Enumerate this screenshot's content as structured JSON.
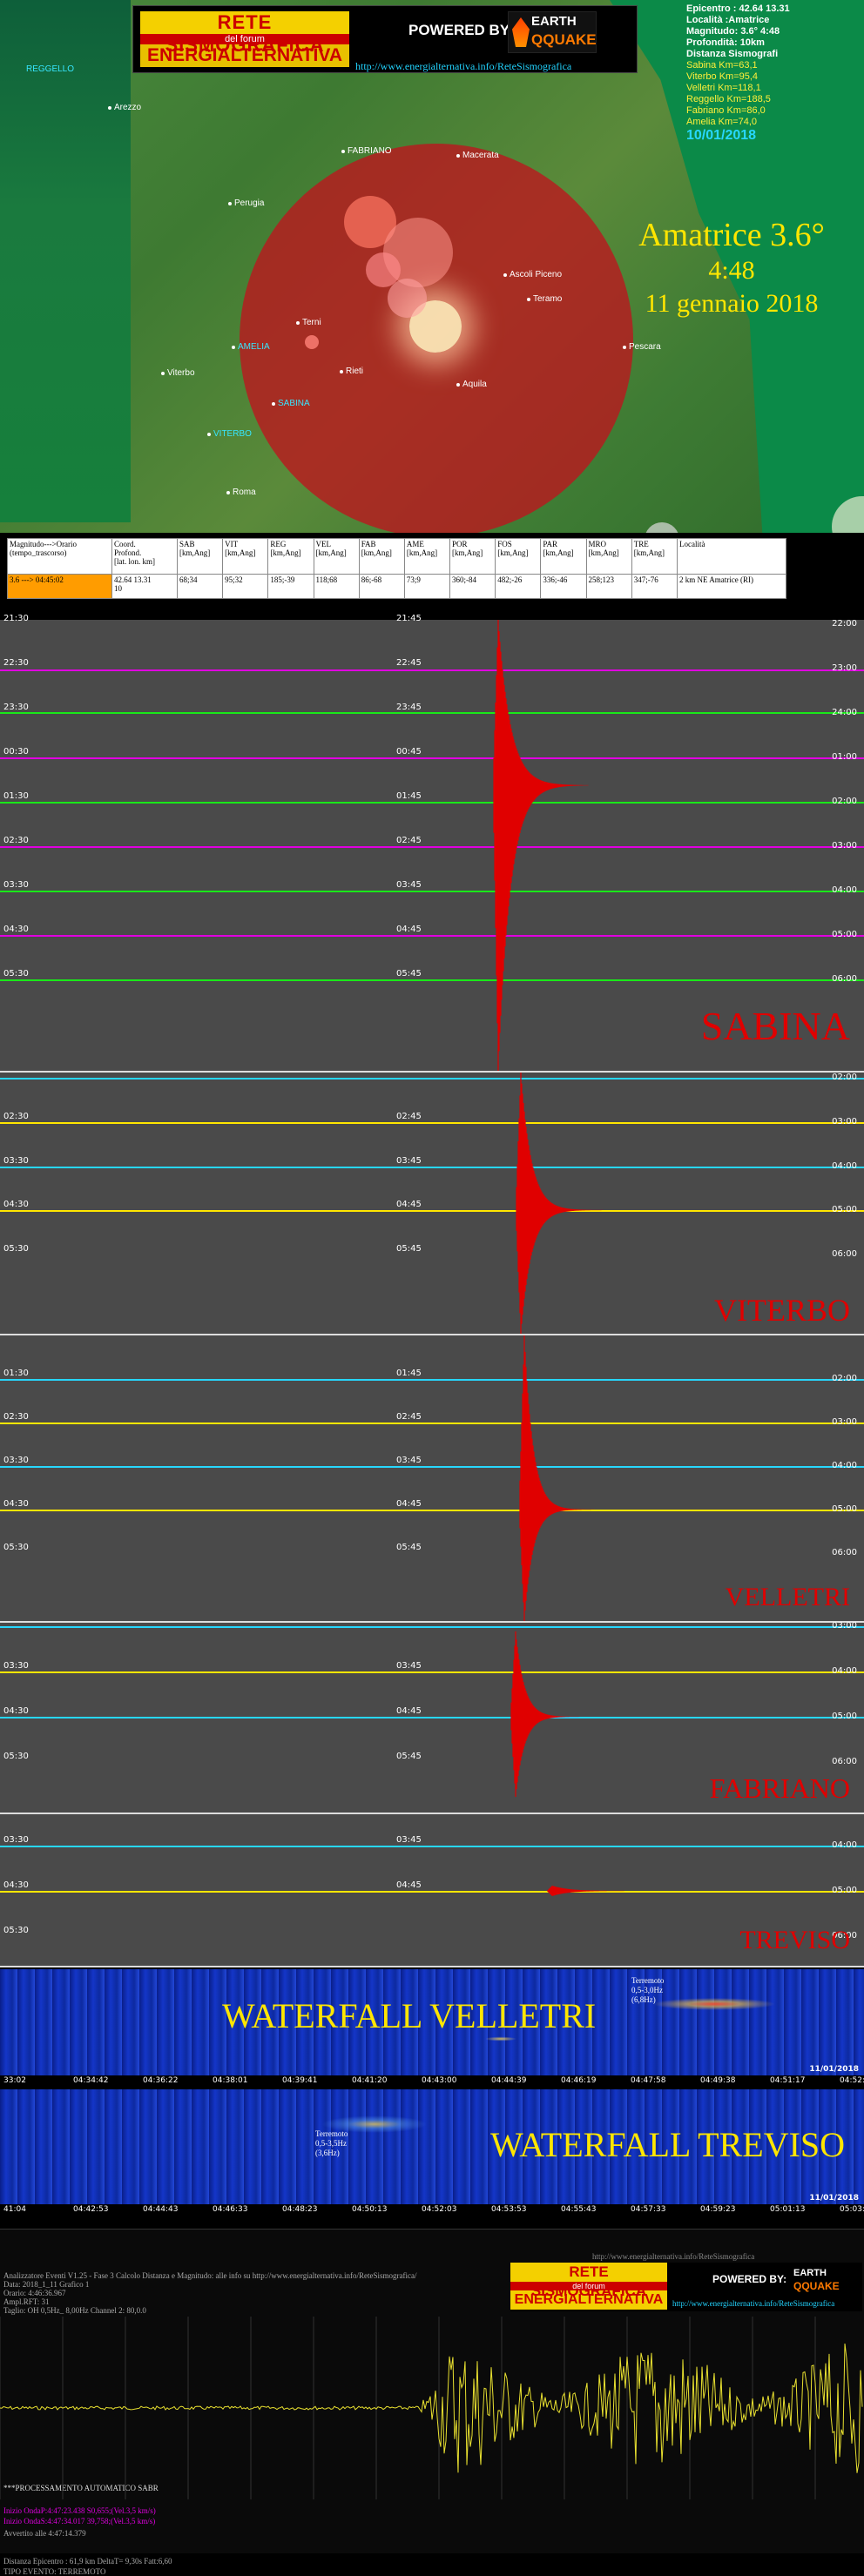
{
  "banner": {
    "rete": "RETE SISMOGRAFICA",
    "forum": "del forum",
    "energ": "ENERGIALTERNATIVA",
    "powered": "POWERED BY:",
    "logo_top": "EARTH",
    "logo_bottom": "QQUAKE",
    "url": "http://www.energialternativa.info/ReteSismografica"
  },
  "info": {
    "epicentro": "Epicentro : 42.64 13.31",
    "localita": "Località :Amatrice",
    "magnitudo": "Magnitudo: 3.6° 4:48",
    "profondita": "Profondità: 10km",
    "distanza": "Distanza Sismografi",
    "dists": [
      "Sabina Km=63,1",
      "Viterbo Km=95,4",
      "Velletri Km=118,1",
      "Reggello Km=188,5",
      "Fabriano Km=86,0",
      "Amelia Km=74,0"
    ],
    "date": "10/01/2018"
  },
  "map": {
    "cities": [
      "REGGELLO",
      "Arezzo",
      "Perugia",
      "FABRIANO",
      "Macerata",
      "Ascoli Piceno",
      "Teramo",
      "Pescara",
      "Terni",
      "AMELIA",
      "Viterbo",
      "Rieti",
      "Aquila",
      "SABINA",
      "VITERBO",
      "Roma"
    ]
  },
  "event_title": {
    "place": "Amatrice 3.6°",
    "time": "4:48",
    "date": "11 gennaio 2018"
  },
  "table": {
    "headers": [
      "Magnitudo--->Orario\n(tempo_trascorso)",
      "Coord.\nProfond.\n[lat. lon. km]",
      "SAB\n[km,Ang]",
      "VIT\n[km,Ang]",
      "REG\n[km,Ang]",
      "VEL\n[km,Ang]",
      "FAB\n[km,Ang]",
      "AME\n[km,Ang]",
      "POR\n[km,Ang]",
      "FOS\n[km,Ang]",
      "PAR\n[km,Ang]",
      "MRO\n[km,Ang]",
      "TRE\n[km,Ang]",
      "Località"
    ],
    "row": [
      "3.6 ---> 04:45:02",
      "42.64 13.31\n10",
      "68;34",
      "95;32",
      "185;-39",
      "118;68",
      "86;-68",
      "73;9",
      "360;-84",
      "482;-26",
      "336;-46",
      "258;123",
      "347;-76",
      "2 km NE Amatrice (RI)"
    ]
  },
  "stations": {
    "sabina": {
      "name": "SABINA",
      "left_times": [
        "21:30",
        "22:30",
        "23:30",
        "00:30",
        "01:30",
        "02:30",
        "03:30",
        "04:30",
        "05:30"
      ],
      "mid_times": [
        "21:45",
        "22:45",
        "23:45",
        "00:45",
        "01:45",
        "02:45",
        "03:45",
        "04:45",
        "05:45"
      ],
      "right_times": [
        "22:00",
        "23:00",
        "24:00",
        "01:00",
        "02:00",
        "03:00",
        "04:00",
        "05:00",
        "06:00"
      ]
    },
    "viterbo": {
      "name": "VITERBO",
      "left_times": [
        "02:30",
        "03:30",
        "04:30",
        "05:30"
      ],
      "mid_times": [
        "02:45",
        "03:45",
        "04:45",
        "05:45"
      ],
      "right_times": [
        "02:00",
        "03:00",
        "04:00",
        "05:00",
        "06:00"
      ]
    },
    "velletri": {
      "name": "VELLETRI",
      "left_times": [
        "01:30",
        "02:30",
        "03:30",
        "04:30",
        "05:30"
      ],
      "mid_times": [
        "01:45",
        "02:45",
        "03:45",
        "04:45",
        "05:45"
      ],
      "right_times": [
        "02:00",
        "03:00",
        "04:00",
        "05:00",
        "06:00"
      ]
    },
    "fabriano": {
      "name": "FABRIANO",
      "left_times": [
        "03:30",
        "04:30",
        "05:30"
      ],
      "mid_times": [
        "03:45",
        "04:45",
        "05:45"
      ],
      "right_times": [
        "03:00",
        "04:00",
        "05:00",
        "06:00"
      ]
    },
    "treviso": {
      "name": "TREVISO",
      "left_times": [
        "03:30",
        "04:30",
        "05:30"
      ],
      "mid_times": [
        "03:45",
        "04:45"
      ],
      "right_times": [
        "04:00",
        "05:00",
        "06:00"
      ]
    }
  },
  "waterfall_velletri": {
    "label": "WATERFALL VELLETRI",
    "note": [
      "Terremoto",
      "0,5-3,0Hz",
      "(6,8Hz)"
    ],
    "date": "11/01/2018",
    "ticks": [
      "33:02",
      "04:34:42",
      "04:36:22",
      "04:38:01",
      "04:39:41",
      "04:41:20",
      "04:43:00",
      "04:44:39",
      "04:46:19",
      "04:47:58",
      "04:49:38",
      "04:51:17",
      "04:52:57"
    ]
  },
  "waterfall_treviso": {
    "label": "WATERFALL TREVISO",
    "note": [
      "Terremoto",
      "0,5-3,5Hz",
      "(3,6Hz)"
    ],
    "date": "11/01/2018",
    "ticks": [
      "41:04",
      "04:42:53",
      "04:44:43",
      "04:46:33",
      "04:48:23",
      "04:50:13",
      "04:52:03",
      "04:53:53",
      "04:55:43",
      "04:57:33",
      "04:59:23",
      "05:01:13",
      "05:03:03"
    ]
  },
  "bottom": {
    "url_top": "http://www.energialternativa.info/ReteSismografica",
    "lines": [
      "Analizzatore Eventi V1.25 - Fase 3 Calcolo Distanza e Magnitudo: alle info su http://www.energialternativa.info/ReteSismografica/",
      "Data: 2018_1_11 Grafico 1",
      "Orario: 4:46:36.967",
      "Ampl.RFT: 31",
      "Taglio: OH 0,5Hz_ 8,00Hz      Channel 2: 80,0.0",
      "***PROCESSAMENTO AUTOMATICO SABR",
      "Inizio OndaP:4:47:23.438 S0,655;(Vel.3,5 km/s)",
      "Inizio OndaS:4:47:34.017 39,758;(Vel.3,5 km/s)",
      "Avvertito alle 4:47:14.379",
      "Distanza Epicentro : 61,9 km DeltaT= 9,30s  Fatt:6,60",
      "TIPO EVENTO: TERREMOTO"
    ]
  },
  "colors": {
    "accent": "#e00000",
    "yellow": "#ffe600",
    "cyan": "#27d7ff",
    "magenta": "#e000e0",
    "green": "#19e819"
  }
}
